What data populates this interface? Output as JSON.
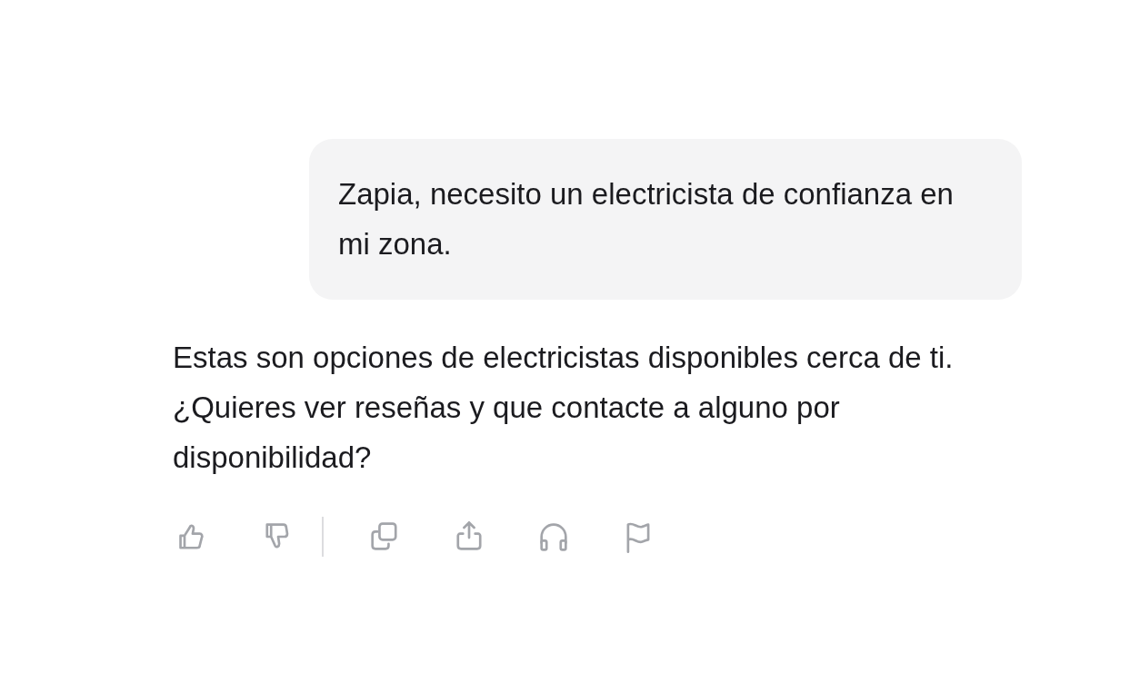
{
  "user_message": "Zapia, necesito un electricista de confianza en mi zona.",
  "assistant_message": "Estas son opciones de electricistas disponibles cerca de ti. ¿Quieres ver reseñas y que contacte a alguno por disponibilidad?",
  "actions": [
    {
      "kind": "like"
    },
    {
      "kind": "dislike"
    },
    {
      "kind": "divider"
    },
    {
      "kind": "copy"
    },
    {
      "kind": "share"
    },
    {
      "kind": "listen"
    },
    {
      "kind": "report"
    }
  ]
}
